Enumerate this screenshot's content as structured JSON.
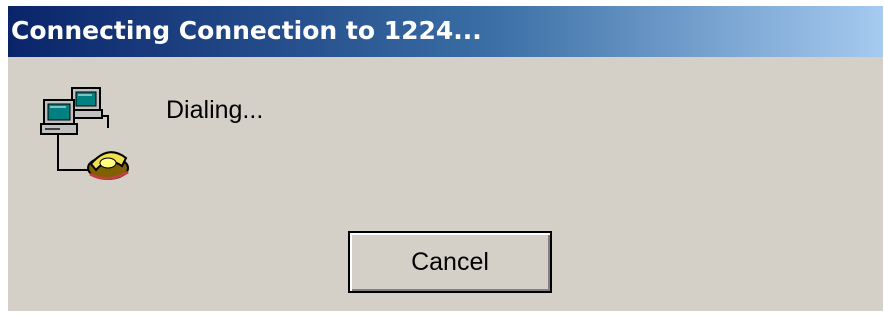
{
  "window": {
    "title": "Connecting Connection to 1224..."
  },
  "status": {
    "text": "Dialing..."
  },
  "buttons": {
    "cancel_label": "Cancel"
  },
  "icons": {
    "status_icon": "dial-up-computers-phone-icon"
  },
  "colors": {
    "titlebar_start": "#0a246a",
    "titlebar_end": "#a6caf0",
    "dialog_face": "#d4d0c8"
  }
}
